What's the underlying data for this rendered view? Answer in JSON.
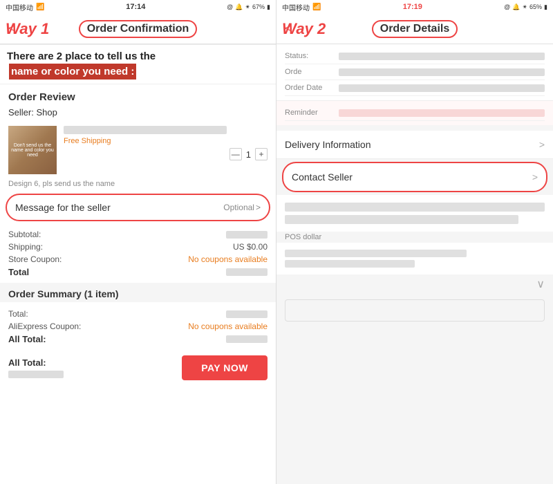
{
  "left": {
    "statusBar": {
      "carrier": "中国移动",
      "wifi": "WiFi",
      "time": "17:14",
      "battery": "67%"
    },
    "wayLabel": "Way 1",
    "headerTitle": "Order Confirmation",
    "backLabel": "<",
    "content": {
      "sectionTitle": "Order Review",
      "sellerLabel": "Seller:  Shop",
      "productNameBlur": "",
      "shippingLabel": "Free Shipping",
      "qtyMinus": "—",
      "qty": "1",
      "qtyPlus": "+",
      "productNote": "Design 6, pls send us the name",
      "messageForSeller": "Message for the seller",
      "optional": "Optional",
      "optionalChevron": ">",
      "subtotalLabel": "Subtotal:",
      "shippingCostLabel": "Shipping:",
      "shippingCost": "US $0.00",
      "storeCouponLabel": "Store Coupon:",
      "noCoupons": "No coupons available",
      "totalLabel": "Total",
      "orderSummaryTitle": "Order Summary (1 item)",
      "summaryTotalLabel": "Total:",
      "aliexpressCouponLabel": "AliExpress Coupon:",
      "noAliCoupons": "No coupons available",
      "allTotalBold": "All Total:",
      "allTotalBottom": "All Total:",
      "payNow": "PAY NOW"
    }
  },
  "right": {
    "statusBar": {
      "carrier": "中国移动",
      "wifi": "WiFi",
      "time": "17:19",
      "battery": "65%"
    },
    "wayLabel": "Way 2",
    "headerTitle": "Order Details",
    "backLabel": "<",
    "content": {
      "statusLabel": "Status:",
      "orderLabel": "Orde",
      "orderDateLabel": "Order Date",
      "reminderLabel": "Reminder",
      "deliveryInfo": "Delivery Information",
      "contactSeller": "Contact Seller",
      "posDollar": "POS dollar",
      "chevron": ">"
    }
  },
  "overlayBanner": {
    "part1": "There are 2 place to tell us the",
    "part2": " name or color you need :"
  }
}
